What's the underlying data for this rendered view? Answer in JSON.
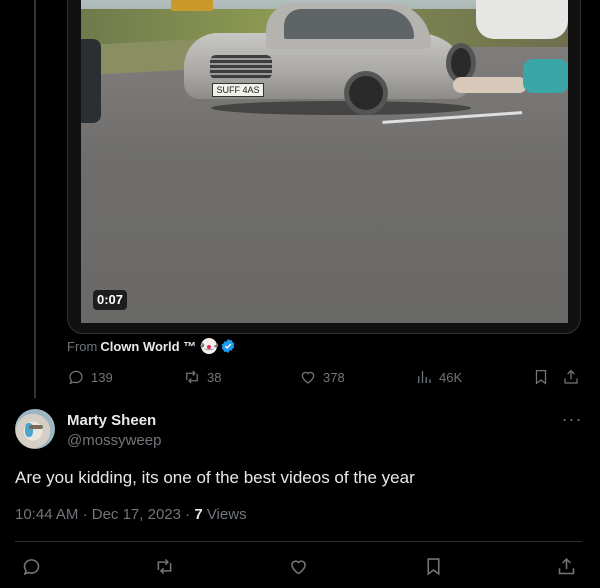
{
  "video": {
    "duration": "0:07",
    "plate_text": "SUFF 4AS"
  },
  "source": {
    "prefix": "From",
    "account_name": "Clown World ™",
    "verified": true
  },
  "quoted_actions": {
    "replies": "139",
    "reposts": "38",
    "likes": "378",
    "views": "46K"
  },
  "reply": {
    "display_name": "Marty Sheen",
    "handle": "@mossyweep",
    "text": "Are you kidding, its one of the best videos of the year",
    "time": "10:44 AM",
    "separator": "·",
    "date": "Dec 17, 2023",
    "views_count": "7",
    "views_label": "Views"
  },
  "icons": {
    "reply": "reply-icon",
    "repost": "repost-icon",
    "like": "heart-icon",
    "views": "views-chart-icon",
    "bookmark": "bookmark-icon",
    "share": "share-icon",
    "more": "more-icon",
    "verified": "verified-badge-icon"
  },
  "colors": {
    "background": "#000000",
    "text_primary": "#e7e9ea",
    "text_secondary": "#71767b",
    "border": "#2f3336",
    "verified": "#1d9bf0"
  }
}
